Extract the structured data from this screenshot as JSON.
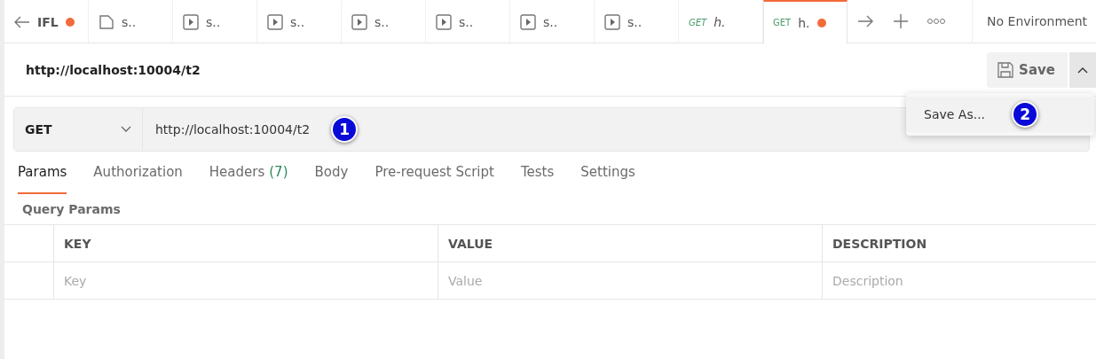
{
  "tabs": [
    {
      "kind": "workspace",
      "label": "IFL",
      "unsaved": true,
      "selected": false
    },
    {
      "kind": "document",
      "label": "s..",
      "unsaved": false,
      "selected": false
    },
    {
      "kind": "example",
      "label": "s..",
      "unsaved": false,
      "selected": false
    },
    {
      "kind": "example",
      "label": "s..",
      "unsaved": false,
      "selected": false
    },
    {
      "kind": "example",
      "label": "s..",
      "unsaved": false,
      "selected": false
    },
    {
      "kind": "example",
      "label": "s..",
      "unsaved": false,
      "selected": false
    },
    {
      "kind": "example",
      "label": "s..",
      "unsaved": false,
      "selected": false
    },
    {
      "kind": "example",
      "label": "s..",
      "unsaved": false,
      "selected": false
    },
    {
      "kind": "request",
      "method": "GET",
      "label": "h.",
      "preview": true,
      "unsaved": false,
      "selected": false
    },
    {
      "kind": "request",
      "method": "GET",
      "label": "h.",
      "preview": false,
      "unsaved": true,
      "selected": true
    }
  ],
  "environment": "No Environment",
  "request_title": "http://localhost:10004/t2",
  "save_button": "Save",
  "save_menu": {
    "items": [
      {
        "label": "Save As...",
        "marker": "2"
      }
    ]
  },
  "method": "GET",
  "url": "http://localhost:10004/t2",
  "url_marker": "1",
  "request_tabs": [
    {
      "label": "Params",
      "selected": true
    },
    {
      "label": "Authorization",
      "selected": false
    },
    {
      "label": "Headers",
      "count": "(7)",
      "selected": false
    },
    {
      "label": "Body",
      "selected": false
    },
    {
      "label": "Pre-request Script",
      "selected": false
    },
    {
      "label": "Tests",
      "selected": false
    },
    {
      "label": "Settings",
      "selected": false
    }
  ],
  "section_title": "Query Params",
  "table": {
    "columns": [
      "KEY",
      "VALUE",
      "DESCRIPTION"
    ],
    "placeholders": [
      "Key",
      "Value",
      "Description"
    ]
  }
}
